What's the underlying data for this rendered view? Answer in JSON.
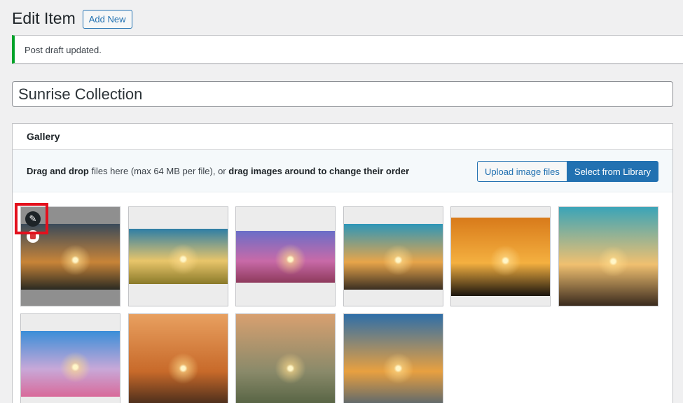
{
  "header": {
    "title": "Edit Item",
    "add_new_label": "Add New"
  },
  "notice": {
    "text": "Post draft updated."
  },
  "post": {
    "title_value": "Sunrise Collection"
  },
  "gallery": {
    "heading": "Gallery",
    "dropzone": {
      "lead_bold": "Drag and drop",
      "middle": " files here (max 64 MB per file), or ",
      "tail_bold": "drag images around to change their order"
    },
    "upload_label": "Upload image files",
    "library_label": "Select from Library",
    "tile_actions": {
      "edit_icon": "pencil-icon",
      "delete_icon": "trash-icon"
    },
    "images": [
      {
        "name": "sunrise-over-clouds",
        "palette": [
          "#3a4a5a",
          "#c88438",
          "#2a2a22"
        ]
      },
      {
        "name": "sunrise-over-field",
        "palette": [
          "#2e7ea6",
          "#e8c56a",
          "#8a7a2a"
        ]
      },
      {
        "name": "purple-beach-sunset",
        "palette": [
          "#6a6ec8",
          "#c86aa8",
          "#8e3a5c"
        ]
      },
      {
        "name": "sunburst-over-hills",
        "palette": [
          "#2d96b8",
          "#e8a54a",
          "#3a2e22"
        ]
      },
      {
        "name": "orange-sea-sunset",
        "palette": [
          "#d87a1a",
          "#f4b040",
          "#1a140e"
        ]
      },
      {
        "name": "sun-behind-hills",
        "palette": [
          "#3aa4b8",
          "#f0c070",
          "#3a2a1e"
        ]
      },
      {
        "name": "pink-coastline-dusk",
        "palette": [
          "#3a8ed8",
          "#c8a8d8",
          "#d86a9a"
        ]
      },
      {
        "name": "orange-mountain-haze",
        "palette": [
          "#e8a060",
          "#c86a2a",
          "#2a1e18"
        ]
      },
      {
        "name": "grass-at-sunrise",
        "palette": [
          "#d8a070",
          "#8a8a6a",
          "#4a5a3a"
        ]
      },
      {
        "name": "ocean-sun-reflection",
        "palette": [
          "#2e6ea8",
          "#e8a040",
          "#3a5a78"
        ]
      }
    ]
  }
}
